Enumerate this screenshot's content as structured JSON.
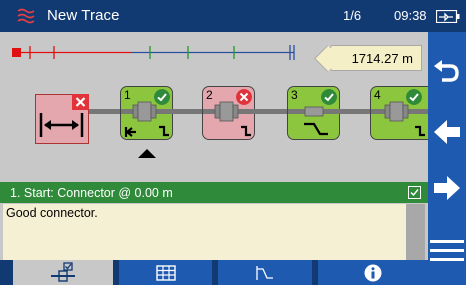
{
  "titlebar": {
    "title": "New Trace",
    "pager": "1/6",
    "clock": "09:38",
    "app_icon": "trace-wave-icon",
    "battery_icon": "battery-charging-icon"
  },
  "distance": {
    "value": "1714.27 m"
  },
  "events": [
    {
      "num": "1",
      "status": "pass",
      "icon": "connector-icon"
    },
    {
      "num": "2",
      "status": "fail",
      "icon": "connector-icon"
    },
    {
      "num": "3",
      "status": "pass",
      "icon": "splice-icon"
    },
    {
      "num": "4",
      "status": "pass",
      "icon": "connector-icon"
    }
  ],
  "selected_event": {
    "header": "1. Start: Connector @ 0.00 m",
    "comment": "Good connector."
  },
  "rail": {
    "icons": [
      "undo-icon",
      "arrow-left-icon",
      "arrow-right-icon",
      "menu-icon"
    ]
  },
  "tabs": {
    "icons": [
      "events-tab-icon",
      "table-icon",
      "trace-graph-icon",
      "info-icon"
    ]
  },
  "colors": {
    "titlebar": "#123a72",
    "rail": "#1e5ab0",
    "panel": "#c8c8c8",
    "pass": "#8cc63f",
    "fail": "#e3a7ad",
    "header": "#2f8a3a",
    "comment_bg": "#f5f0d4",
    "distance_bg": "#f5efc8"
  }
}
